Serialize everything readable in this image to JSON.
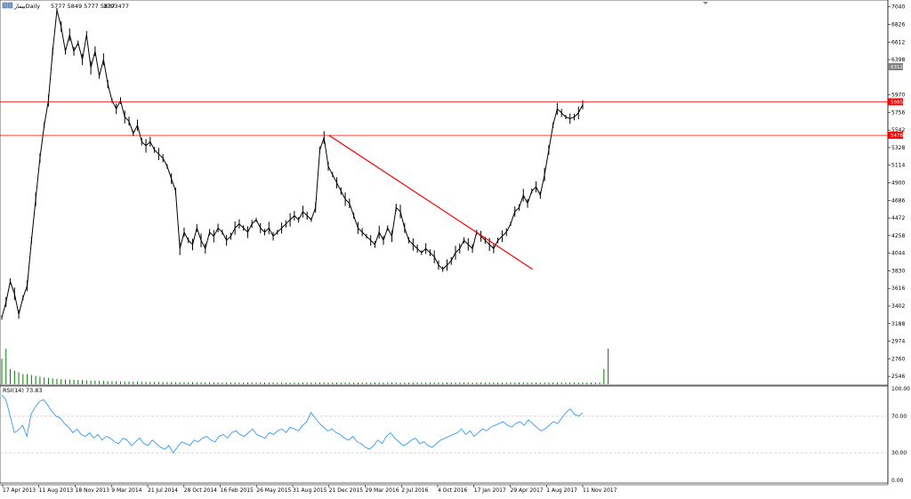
{
  "header": {
    "symbol_label": "بیمارDaily",
    "ohlc_text": "5777 5849 5777 5837",
    "volume_text": "3793477"
  },
  "colors": {
    "background": "#ffffff",
    "price": "#000000",
    "volume": "#008000",
    "rsi_line": "#1e90ff",
    "hline": "#ff0000",
    "trendline": "#ff0000",
    "grid": "#c0c0c0",
    "price_tag_red": "#ff0000",
    "price_tag_gray": "#808080"
  },
  "main_axis": {
    "labels": [
      "7040",
      "6826",
      "6612",
      "6398",
      "5970",
      "5756",
      "5542",
      "5328",
      "5114",
      "4900",
      "4686",
      "4472",
      "4258",
      "4044",
      "3830",
      "3616",
      "3402",
      "3188",
      "2974",
      "2760",
      "2546"
    ],
    "tags": [
      {
        "text": "5885",
        "value": 5885,
        "color": "red"
      },
      {
        "text": "5478",
        "value": 5478,
        "color": "red"
      },
      {
        "text": "6312",
        "value": 6312,
        "color": "gray"
      }
    ]
  },
  "rsi": {
    "label": "RSI(14) 73.83",
    "axis_labels": [
      "100.00",
      "70.00",
      "30.00",
      "0.00"
    ],
    "levels": [
      70,
      30
    ]
  },
  "time_axis": {
    "labels": [
      "17 Apr 2013",
      "11 Aug 2013",
      "18 Nov 2013",
      "9 Mar 2014",
      "21 Jul 2014",
      "28 Oct 2014",
      "16 Feb 2015",
      "26 May 2015",
      "31 Aug 2015",
      "21 Dec 2015",
      "29 Mar 2016",
      "2 Jul 2016",
      "4 Oct 2016",
      "17 Jan 2017",
      "29 Apr 2017",
      "1 Aug 2017",
      "11 Nov 2017"
    ]
  },
  "chart_data": {
    "type": "line",
    "title": "",
    "x_labels": [
      "17 Apr 2013",
      "11 Aug 2013",
      "18 Nov 2013",
      "9 Mar 2014",
      "21 Jul 2014",
      "28 Oct 2014",
      "16 Feb 2015",
      "26 May 2015",
      "31 Aug 2015",
      "21 Dec 2015",
      "29 Mar 2016",
      "2 Jul 2016",
      "4 Oct 2016",
      "17 Jan 2017",
      "29 Apr 2017",
      "1 Aug 2017",
      "11 Nov 2017"
    ],
    "ylim": [
      2450,
      7080
    ],
    "series": [
      {
        "values": [
          3260,
          3450,
          3700,
          3550,
          3300,
          3500,
          3650,
          4200,
          4700,
          5200,
          5600,
          5900,
          6500,
          7000,
          6800,
          6500,
          6700,
          6500,
          6600,
          6400,
          6700,
          6300,
          6500,
          6200,
          6400,
          6100,
          5900,
          5800,
          5900,
          5700,
          5650,
          5500,
          5600,
          5400,
          5350,
          5400,
          5300,
          5250,
          5200,
          5100,
          4950,
          4800,
          4100,
          4300,
          4200,
          4150,
          4350,
          4200,
          4100,
          4300,
          4250,
          4350,
          4300,
          4200,
          4250,
          4350,
          4400,
          4350,
          4300,
          4400,
          4450,
          4350,
          4300,
          4350,
          4250,
          4300,
          4350,
          4400,
          4450,
          4500,
          4450,
          4550,
          4500,
          4450,
          4600,
          5300,
          5450,
          5100,
          5000,
          4900,
          4800,
          4700,
          4650,
          4500,
          4350,
          4300,
          4250,
          4200,
          4150,
          4300,
          4200,
          4350,
          4250,
          4600,
          4550,
          4350,
          4200,
          4150,
          4100,
          4050,
          4100,
          4050,
          4000,
          3900,
          3850,
          3900,
          3950,
          4050,
          4100,
          4200,
          4150,
          4100,
          4300,
          4250,
          4200,
          4150,
          4100,
          4200,
          4250,
          4300,
          4400,
          4550,
          4600,
          4750,
          4650,
          4800,
          4850,
          4750,
          5000,
          5300,
          5600,
          5800,
          5750,
          5700,
          5680,
          5700,
          5750,
          5850
        ]
      }
    ],
    "volume": [
      150,
      210,
      90,
      80,
      70,
      60,
      60,
      55,
      50,
      45,
      40,
      38,
      35,
      32,
      30,
      28,
      28,
      26,
      25,
      25,
      24,
      22,
      22,
      20,
      20,
      18,
      18,
      18,
      16,
      16,
      16,
      15,
      15,
      15,
      14,
      14,
      14,
      14,
      13,
      13,
      13,
      12,
      12,
      12,
      12,
      12,
      12,
      11,
      11,
      11,
      11,
      11,
      10,
      10,
      10,
      10,
      10,
      10,
      10,
      10,
      10,
      10,
      10,
      10,
      10,
      10,
      10,
      10,
      10,
      10,
      10,
      10,
      10,
      10,
      10,
      10,
      10,
      10,
      10,
      10,
      10,
      10,
      10,
      10,
      10,
      10,
      10,
      10,
      10,
      10,
      10,
      10,
      10,
      10,
      10,
      10,
      10,
      10,
      10,
      10,
      10,
      10,
      10,
      10,
      10,
      10,
      10,
      10,
      10,
      10,
      10,
      10,
      10,
      10,
      10,
      10,
      10,
      10,
      10,
      10,
      10,
      10,
      10,
      10,
      10,
      10,
      10,
      10,
      10,
      10,
      10,
      10,
      10,
      10,
      10,
      10,
      10,
      10,
      10,
      10,
      10,
      10,
      90,
      210
    ],
    "rsi": [
      93,
      88,
      70,
      52,
      55,
      60,
      48,
      72,
      80,
      86,
      88,
      82,
      75,
      70,
      68,
      62,
      58,
      52,
      56,
      50,
      48,
      52,
      46,
      50,
      44,
      48,
      46,
      42,
      40,
      46,
      44,
      38,
      42,
      46,
      40,
      38,
      44,
      40,
      36,
      34,
      38,
      30,
      36,
      42,
      40,
      38,
      44,
      42,
      46,
      48,
      44,
      42,
      48,
      50,
      46,
      52,
      54,
      50,
      48,
      52,
      56,
      50,
      48,
      46,
      52,
      50,
      54,
      56,
      52,
      58,
      56,
      54,
      60,
      64,
      74,
      68,
      62,
      58,
      54,
      56,
      52,
      50,
      46,
      44,
      48,
      42,
      40,
      36,
      34,
      38,
      44,
      40,
      48,
      52,
      46,
      42,
      38,
      40,
      44,
      46,
      40,
      42,
      38,
      36,
      40,
      44,
      46,
      48,
      50,
      52,
      56,
      50,
      54,
      48,
      52,
      56,
      54,
      58,
      60,
      62,
      64,
      60,
      58,
      62,
      64,
      60,
      66,
      62,
      58,
      54,
      56,
      60,
      64,
      62,
      68,
      74,
      78,
      72,
      70,
      73.83
    ],
    "hlines": [
      5885,
      5478
    ],
    "trendline": {
      "from": {
        "x": "21 Dec 2015",
        "y": 5478
      },
      "to": {
        "x": "29 Apr 2017",
        "y": 3850
      }
    },
    "rsi_ylim": [
      0,
      100
    ]
  }
}
